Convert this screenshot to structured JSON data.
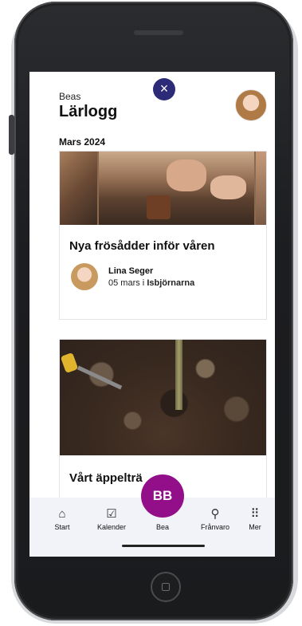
{
  "header": {
    "subtitle": "Beas",
    "title": "Lärlogg"
  },
  "close_icon": "×",
  "section": {
    "month": "Mars 2024"
  },
  "posts": [
    {
      "title": "Nya frösådder inför våren",
      "author": "Lina Seger",
      "date": "05 mars i",
      "group": "Isbjörnarna"
    },
    {
      "title": "Vårt äppelträ"
    }
  ],
  "bottom_nav": {
    "items": [
      {
        "label": "Start",
        "icon": "home-icon"
      },
      {
        "label": "Kalender",
        "icon": "calendar-icon"
      },
      {
        "label": "Frånvaro",
        "icon": "absence-icon"
      },
      {
        "label": "Mer",
        "icon": "grid-icon"
      }
    ],
    "fab": {
      "initials": "BB",
      "label": "Bea",
      "color": "#930f8a"
    }
  },
  "colors": {
    "close_button": "#2d2a78",
    "nav_background": "#f1f3f8"
  }
}
